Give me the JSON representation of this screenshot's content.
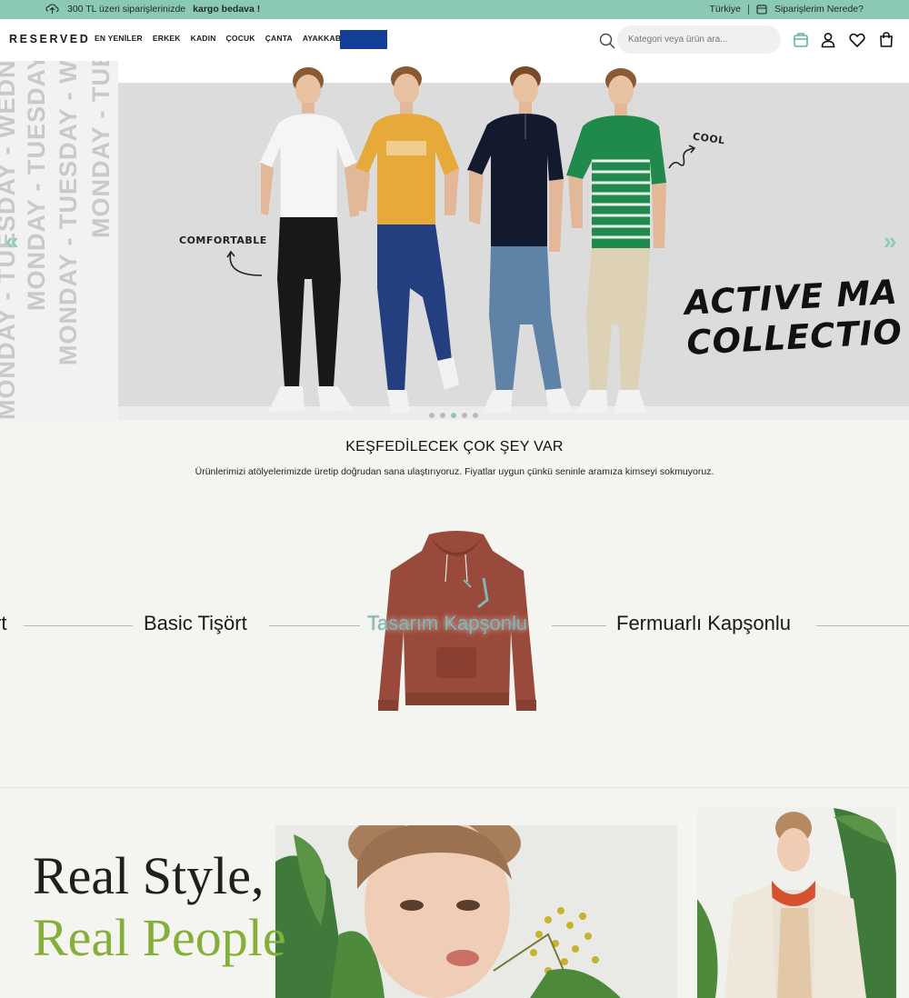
{
  "promo": {
    "shipping_text": "300 TL üzeri siparişlerinizde",
    "shipping_bold": "kargo bedava !",
    "country": "Türkiye",
    "orders_link": "Siparişlerim Nerede?"
  },
  "header": {
    "logo": "RESERVED",
    "nav": [
      "EN YENİLER",
      "ERKEK",
      "KADIN",
      "ÇOCUK",
      "ÇANTA",
      "AYAKKABI"
    ],
    "search_placeholder": "Kategori veya ürün ara..."
  },
  "hero": {
    "days_text": "MONDAY - TUESDAY - WEDNESDAY - THURSDAY - FRIDAY - SATURDAY",
    "label_comfortable": "COMFORTABLE",
    "label_cool": "COOL",
    "collection_line1": "ACTIVE MA",
    "collection_line2": "COLLECTIO",
    "slides": 5,
    "active_slide": 3
  },
  "discover": {
    "title": "KEŞFEDİLECEK ÇOK ŞEY VAR",
    "subtitle": "Ürünlerimizi atölyelerimizde üretip doğrudan sana ulaştırıyoruz. Fiyatlar uygun çünkü seninle aramıza kimseyi sokmuyoruz.",
    "categories": [
      "rt",
      "Basic Tişört",
      "Tasarım Kapşonlu",
      "Fermuarlı Kapşonlu"
    ]
  },
  "real_style": {
    "line1": "Real Style,",
    "line2": "Real People"
  },
  "colors": {
    "accent": "#8cc8b6",
    "flag_blue": "#133f99",
    "green_text": "#86ae3a",
    "hoodie": "#9a4a3a"
  }
}
